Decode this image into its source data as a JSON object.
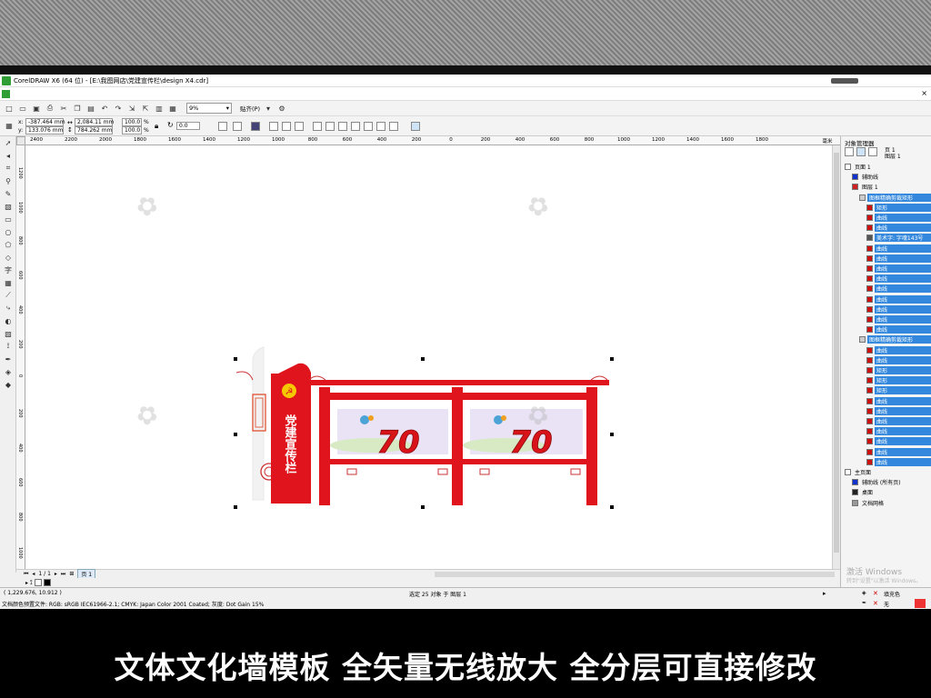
{
  "window": {
    "title": "CorelDRAW X6 (64 位) - [E:\\我图网店\\党建宣传栏\\design X4.cdr]"
  },
  "toolbar": {
    "zoom_value": "9%",
    "snap_label": "贴齐(P)"
  },
  "property_bar": {
    "x_value": "-387.464 mm",
    "y_value": "133.076 mm",
    "width_value": "2,084.11 mm",
    "height_value": "784.262 mm",
    "scale_x": "100.0",
    "scale_y": "100.0",
    "percent_sign": "%",
    "rotation_value": "0.0",
    "x_label": "x:",
    "y_label": "y:"
  },
  "ruler": {
    "h_ticks": [
      "2400",
      "2200",
      "2000",
      "1800",
      "1600",
      "1400",
      "1200",
      "1000",
      "800",
      "600",
      "400",
      "200",
      "0",
      "200",
      "400",
      "600",
      "800",
      "1000",
      "1200",
      "1400",
      "1600",
      "1800"
    ],
    "h_unit": "毫米",
    "v_ticks": [
      "1200",
      "1000",
      "800",
      "600",
      "400",
      "200",
      "0",
      "200",
      "400",
      "600",
      "800",
      "1000"
    ]
  },
  "design": {
    "vertical_title": "党建宣传栏",
    "panel_number": "70"
  },
  "page_nav": {
    "page_counter": "1 / 1",
    "page_tab": "页 1"
  },
  "status": {
    "cursor_coords": "( 1,229.676, 10.912 )",
    "selection_info": "选定 25 对象 于 图层 1",
    "color_profile": "文档颜色预置文件: RGB: sRGB IEC61966-2.1; CMYK: Japan Color 2001 Coated; 灰度: Dot Gain 15%",
    "fill_label": "填充色",
    "outline_label": "无"
  },
  "object_manager": {
    "title": "对象管理器",
    "page_header": "页 1",
    "layer_header": "图层 1",
    "rows": [
      {
        "label": "页面 1",
        "color": "#ffffff",
        "selected": false,
        "level": 0
      },
      {
        "label": "辅助线",
        "color": "#1133cc",
        "selected": false,
        "level": 1
      },
      {
        "label": "图层 1",
        "color": "#cc2222",
        "selected": false,
        "level": 1
      },
      {
        "label": "图框精确剪裁矩形",
        "color": "#cccccc",
        "selected": true,
        "level": 2
      },
      {
        "label": "矩形",
        "color": "#cc1111",
        "selected": true,
        "level": 3
      },
      {
        "label": "曲线",
        "color": "#cc1111",
        "selected": true,
        "level": 3
      },
      {
        "label": "曲线",
        "color": "#cc1111",
        "selected": true,
        "level": 3
      },
      {
        "label": "美术字: 字魂143号",
        "color": "#555555",
        "selected": true,
        "level": 3
      },
      {
        "label": "曲线",
        "color": "#cc1111",
        "selected": true,
        "level": 3
      },
      {
        "label": "曲线",
        "color": "#cc1111",
        "selected": true,
        "level": 3
      },
      {
        "label": "曲线",
        "color": "#cc1111",
        "selected": true,
        "level": 3
      },
      {
        "label": "曲线",
        "color": "#cc1111",
        "selected": true,
        "level": 3
      },
      {
        "label": "曲线",
        "color": "#cc1111",
        "selected": true,
        "level": 3
      },
      {
        "label": "曲线",
        "color": "#cc1111",
        "selected": true,
        "level": 3
      },
      {
        "label": "曲线",
        "color": "#cc1111",
        "selected": true,
        "level": 3
      },
      {
        "label": "曲线",
        "color": "#cc1111",
        "selected": true,
        "level": 3
      },
      {
        "label": "曲线",
        "color": "#cc1111",
        "selected": true,
        "level": 3
      },
      {
        "label": "图框精确剪裁矩形",
        "color": "#cccccc",
        "selected": true,
        "level": 2
      },
      {
        "label": "曲线",
        "color": "#cc1111",
        "selected": true,
        "level": 3
      },
      {
        "label": "曲线",
        "color": "#cc1111",
        "selected": true,
        "level": 3
      },
      {
        "label": "矩形",
        "color": "#cc1111",
        "selected": true,
        "level": 3
      },
      {
        "label": "矩形",
        "color": "#cc1111",
        "selected": true,
        "level": 3
      },
      {
        "label": "矩形",
        "color": "#cc1111",
        "selected": true,
        "level": 3
      },
      {
        "label": "曲线",
        "color": "#cc1111",
        "selected": true,
        "level": 3
      },
      {
        "label": "曲线",
        "color": "#cc1111",
        "selected": true,
        "level": 3
      },
      {
        "label": "曲线",
        "color": "#cc1111",
        "selected": true,
        "level": 3
      },
      {
        "label": "曲线",
        "color": "#cc1111",
        "selected": true,
        "level": 3
      },
      {
        "label": "曲线",
        "color": "#cc1111",
        "selected": true,
        "level": 3
      },
      {
        "label": "曲线",
        "color": "#cc1111",
        "selected": true,
        "level": 3
      },
      {
        "label": "曲线",
        "color": "#cc1111",
        "selected": true,
        "level": 3
      },
      {
        "label": "主页面",
        "color": "#ffffff",
        "selected": false,
        "level": 0
      },
      {
        "label": "辅助线 (所有页)",
        "color": "#1133cc",
        "selected": false,
        "level": 1
      },
      {
        "label": "桌面",
        "color": "#222222",
        "selected": false,
        "level": 1
      },
      {
        "label": "文档网格",
        "color": "#999999",
        "selected": false,
        "level": 1
      }
    ],
    "windows_watermark": "激活 Windows",
    "windows_watermark_sub": "转到\"设置\"以激活 Windows。"
  },
  "caption": "文体文化墙模板  全矢量无线放大 全分层可直接修改",
  "colors": {
    "accent_red": "#e0141c",
    "selection_blue": "#3388dd",
    "corel_green": "#2f9e35"
  }
}
